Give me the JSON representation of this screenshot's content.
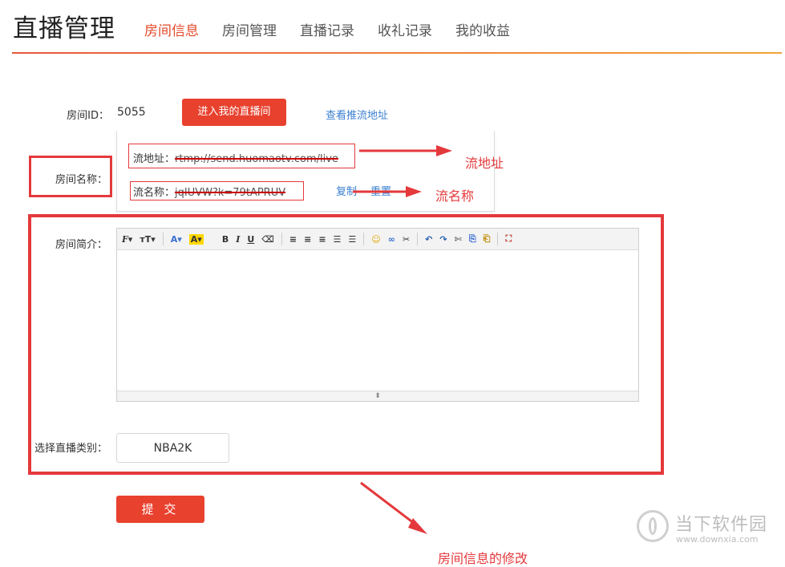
{
  "header": {
    "title": "直播管理",
    "tabs": [
      {
        "label": "房间信息",
        "active": true
      },
      {
        "label": "房间管理",
        "active": false
      },
      {
        "label": "直播记录",
        "active": false
      },
      {
        "label": "收礼记录",
        "active": false
      },
      {
        "label": "我的收益",
        "active": false
      }
    ]
  },
  "form": {
    "room_id_label": "房间ID：",
    "room_id_value": "5055",
    "enter_room_button": "进入我的直播间",
    "push_url_link": "查看推流地址",
    "room_name_label": "房间名称：",
    "stream_address_label": "流地址：",
    "stream_address_value": "rtmp://send.huomaotv.com/live",
    "stream_name_label": "流名称：",
    "stream_name_value": "jqIUVW?k=79tAPRUV",
    "copy_link": "复制",
    "reset_link": "重置",
    "intro_label": "房间简介：",
    "category_label": "选择直播类别：",
    "category_value": "NBA2K",
    "submit_button": "提 交"
  },
  "editor": {
    "toolbar": [
      "F▾",
      "тT▾",
      "A▾",
      "A▾",
      "B",
      "I",
      "U",
      "⌫",
      "≡",
      "≡",
      "≡",
      "☰",
      "☰",
      "☺",
      "∞",
      "✂",
      "↶",
      "↷",
      "✄",
      "⎘",
      "⎗",
      "⛶"
    ],
    "resize_handle": "⬍"
  },
  "annotations": {
    "stream_address": "流地址",
    "stream_name": "流名称",
    "room_info_edit": "房间信息的修改"
  },
  "watermark": {
    "name": "当下软件园",
    "url": "www.downxia.com"
  },
  "colors": {
    "accent": "#e8412e",
    "link": "#3a7fd0",
    "annotation": "#e4393c"
  }
}
